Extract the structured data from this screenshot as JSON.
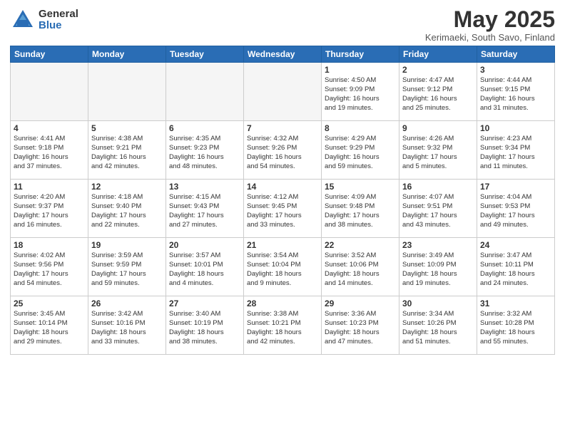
{
  "logo": {
    "general": "General",
    "blue": "Blue"
  },
  "title": {
    "month": "May 2025",
    "location": "Kerimaeki, South Savo, Finland"
  },
  "weekdays": [
    "Sunday",
    "Monday",
    "Tuesday",
    "Wednesday",
    "Thursday",
    "Friday",
    "Saturday"
  ],
  "weeks": [
    [
      {
        "day": "",
        "detail": ""
      },
      {
        "day": "",
        "detail": ""
      },
      {
        "day": "",
        "detail": ""
      },
      {
        "day": "",
        "detail": ""
      },
      {
        "day": "1",
        "detail": "Sunrise: 4:50 AM\nSunset: 9:09 PM\nDaylight: 16 hours\nand 19 minutes."
      },
      {
        "day": "2",
        "detail": "Sunrise: 4:47 AM\nSunset: 9:12 PM\nDaylight: 16 hours\nand 25 minutes."
      },
      {
        "day": "3",
        "detail": "Sunrise: 4:44 AM\nSunset: 9:15 PM\nDaylight: 16 hours\nand 31 minutes."
      }
    ],
    [
      {
        "day": "4",
        "detail": "Sunrise: 4:41 AM\nSunset: 9:18 PM\nDaylight: 16 hours\nand 37 minutes."
      },
      {
        "day": "5",
        "detail": "Sunrise: 4:38 AM\nSunset: 9:21 PM\nDaylight: 16 hours\nand 42 minutes."
      },
      {
        "day": "6",
        "detail": "Sunrise: 4:35 AM\nSunset: 9:23 PM\nDaylight: 16 hours\nand 48 minutes."
      },
      {
        "day": "7",
        "detail": "Sunrise: 4:32 AM\nSunset: 9:26 PM\nDaylight: 16 hours\nand 54 minutes."
      },
      {
        "day": "8",
        "detail": "Sunrise: 4:29 AM\nSunset: 9:29 PM\nDaylight: 16 hours\nand 59 minutes."
      },
      {
        "day": "9",
        "detail": "Sunrise: 4:26 AM\nSunset: 9:32 PM\nDaylight: 17 hours\nand 5 minutes."
      },
      {
        "day": "10",
        "detail": "Sunrise: 4:23 AM\nSunset: 9:34 PM\nDaylight: 17 hours\nand 11 minutes."
      }
    ],
    [
      {
        "day": "11",
        "detail": "Sunrise: 4:20 AM\nSunset: 9:37 PM\nDaylight: 17 hours\nand 16 minutes."
      },
      {
        "day": "12",
        "detail": "Sunrise: 4:18 AM\nSunset: 9:40 PM\nDaylight: 17 hours\nand 22 minutes."
      },
      {
        "day": "13",
        "detail": "Sunrise: 4:15 AM\nSunset: 9:43 PM\nDaylight: 17 hours\nand 27 minutes."
      },
      {
        "day": "14",
        "detail": "Sunrise: 4:12 AM\nSunset: 9:45 PM\nDaylight: 17 hours\nand 33 minutes."
      },
      {
        "day": "15",
        "detail": "Sunrise: 4:09 AM\nSunset: 9:48 PM\nDaylight: 17 hours\nand 38 minutes."
      },
      {
        "day": "16",
        "detail": "Sunrise: 4:07 AM\nSunset: 9:51 PM\nDaylight: 17 hours\nand 43 minutes."
      },
      {
        "day": "17",
        "detail": "Sunrise: 4:04 AM\nSunset: 9:53 PM\nDaylight: 17 hours\nand 49 minutes."
      }
    ],
    [
      {
        "day": "18",
        "detail": "Sunrise: 4:02 AM\nSunset: 9:56 PM\nDaylight: 17 hours\nand 54 minutes."
      },
      {
        "day": "19",
        "detail": "Sunrise: 3:59 AM\nSunset: 9:59 PM\nDaylight: 17 hours\nand 59 minutes."
      },
      {
        "day": "20",
        "detail": "Sunrise: 3:57 AM\nSunset: 10:01 PM\nDaylight: 18 hours\nand 4 minutes."
      },
      {
        "day": "21",
        "detail": "Sunrise: 3:54 AM\nSunset: 10:04 PM\nDaylight: 18 hours\nand 9 minutes."
      },
      {
        "day": "22",
        "detail": "Sunrise: 3:52 AM\nSunset: 10:06 PM\nDaylight: 18 hours\nand 14 minutes."
      },
      {
        "day": "23",
        "detail": "Sunrise: 3:49 AM\nSunset: 10:09 PM\nDaylight: 18 hours\nand 19 minutes."
      },
      {
        "day": "24",
        "detail": "Sunrise: 3:47 AM\nSunset: 10:11 PM\nDaylight: 18 hours\nand 24 minutes."
      }
    ],
    [
      {
        "day": "25",
        "detail": "Sunrise: 3:45 AM\nSunset: 10:14 PM\nDaylight: 18 hours\nand 29 minutes."
      },
      {
        "day": "26",
        "detail": "Sunrise: 3:42 AM\nSunset: 10:16 PM\nDaylight: 18 hours\nand 33 minutes."
      },
      {
        "day": "27",
        "detail": "Sunrise: 3:40 AM\nSunset: 10:19 PM\nDaylight: 18 hours\nand 38 minutes."
      },
      {
        "day": "28",
        "detail": "Sunrise: 3:38 AM\nSunset: 10:21 PM\nDaylight: 18 hours\nand 42 minutes."
      },
      {
        "day": "29",
        "detail": "Sunrise: 3:36 AM\nSunset: 10:23 PM\nDaylight: 18 hours\nand 47 minutes."
      },
      {
        "day": "30",
        "detail": "Sunrise: 3:34 AM\nSunset: 10:26 PM\nDaylight: 18 hours\nand 51 minutes."
      },
      {
        "day": "31",
        "detail": "Sunrise: 3:32 AM\nSunset: 10:28 PM\nDaylight: 18 hours\nand 55 minutes."
      }
    ]
  ]
}
